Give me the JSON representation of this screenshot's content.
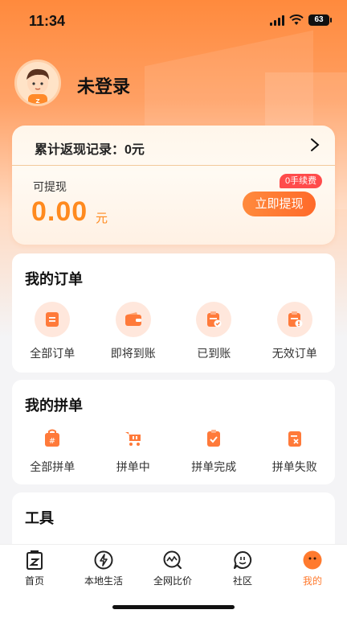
{
  "status_bar": {
    "time": "11:34",
    "battery": "63"
  },
  "profile": {
    "name": "未登录"
  },
  "cashback": {
    "record_label": "累计返现记录：0元",
    "withdrawable_label": "可提现",
    "amount": "0.00",
    "unit": "元",
    "withdraw_button": "立即提现",
    "fee_badge": "0手续费"
  },
  "orders": {
    "title": "我的订单",
    "items": [
      {
        "label": "全部订单",
        "icon": "list-document-icon"
      },
      {
        "label": "即将到账",
        "icon": "wallet-icon"
      },
      {
        "label": "已到账",
        "icon": "received-check-icon"
      },
      {
        "label": "无效订单",
        "icon": "invalid-document-icon"
      }
    ]
  },
  "group_orders": {
    "title": "我的拼单",
    "items": [
      {
        "label": "全部拼单",
        "icon": "bag-icon"
      },
      {
        "label": "拼单中",
        "icon": "cart-icon"
      },
      {
        "label": "拼单完成",
        "icon": "checked-doc-icon"
      },
      {
        "label": "拼单失败",
        "icon": "failed-doc-icon"
      }
    ]
  },
  "tools": {
    "title": "工具"
  },
  "tabbar": {
    "tabs": [
      {
        "label": "首页",
        "icon": "home-bag-icon",
        "active": false
      },
      {
        "label": "本地生活",
        "icon": "lightning-icon",
        "active": false
      },
      {
        "label": "全网比价",
        "icon": "compare-search-icon",
        "active": false
      },
      {
        "label": "社区",
        "icon": "chat-bubble-icon",
        "active": false
      },
      {
        "label": "我的",
        "icon": "profile-face-icon",
        "active": true
      }
    ]
  },
  "colors": {
    "accent": "#ff7a2e",
    "amount": "#ff8a1f",
    "badge": "#ff4b4b"
  }
}
